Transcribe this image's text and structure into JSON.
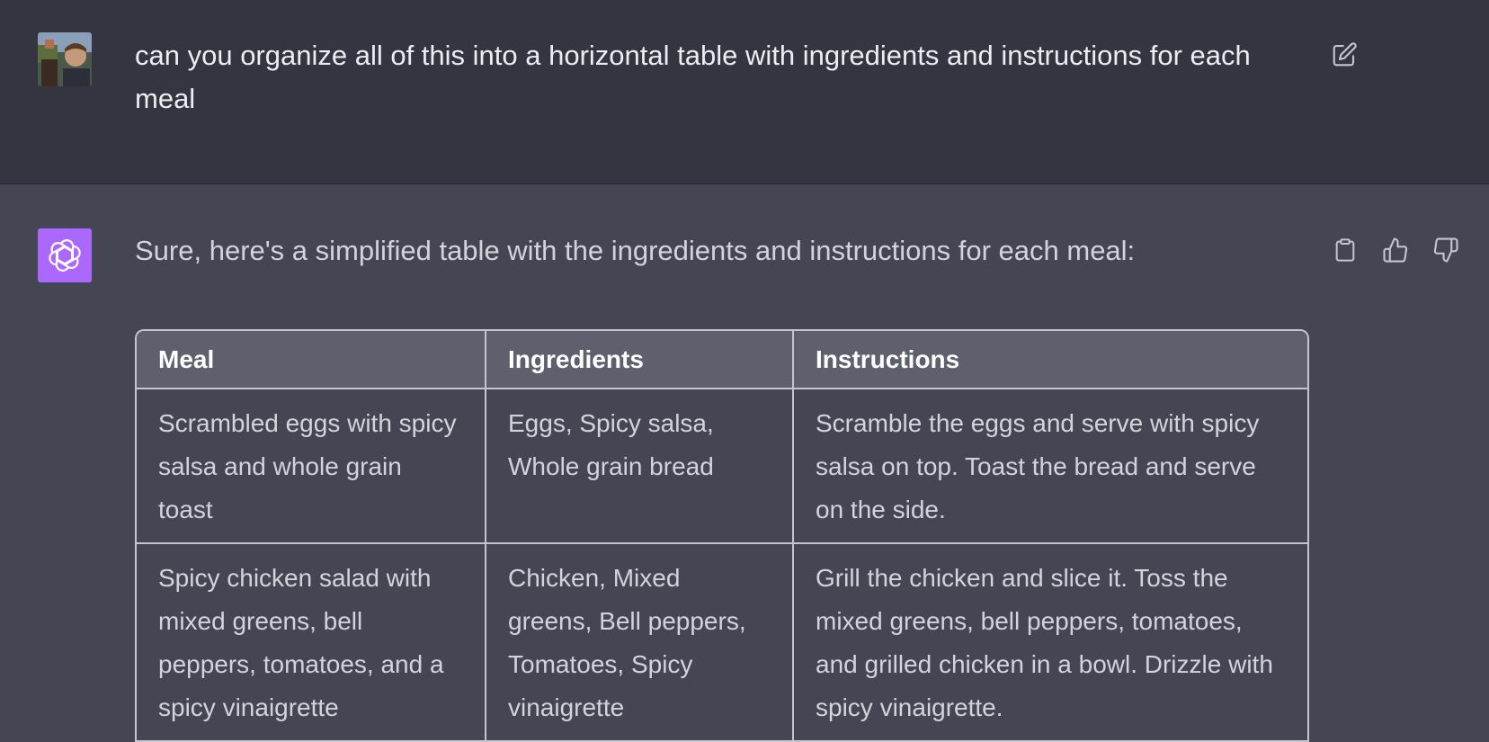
{
  "user_message": {
    "text": "can you organize all of this into a horizontal table with ingredients and instructions for each meal",
    "edit_icon": "edit-icon"
  },
  "assistant_message": {
    "intro": "Sure, here's a simplified table with the ingredients and instructions for each meal:",
    "actions": {
      "copy_icon": "clipboard-icon",
      "thumbs_up_icon": "thumbs-up-icon",
      "thumbs_down_icon": "thumbs-down-icon"
    },
    "table": {
      "headers": [
        "Meal",
        "Ingredients",
        "Instructions"
      ],
      "rows": [
        {
          "meal": "Scrambled eggs with spicy salsa and whole grain toast",
          "ingredients": "Eggs, Spicy salsa, Whole grain bread",
          "instructions": "Scramble the eggs and serve with spicy salsa on top. Toast the bread and serve on the side."
        },
        {
          "meal": "Spicy chicken salad with mixed greens, bell peppers, tomatoes, and a spicy vinaigrette",
          "ingredients": "Chicken, Mixed greens, Bell peppers, Tomatoes, Spicy vinaigrette",
          "instructions": "Grill the chicken and slice it. Toss the mixed greens, bell peppers, tomatoes, and grilled chicken in a bowl. Drizzle with spicy vinaigrette."
        }
      ]
    }
  },
  "colors": {
    "user_bg": "#343541",
    "assistant_bg": "#444654",
    "gpt_avatar": "#ab68ff",
    "table_header_bg": "#5f606e"
  }
}
